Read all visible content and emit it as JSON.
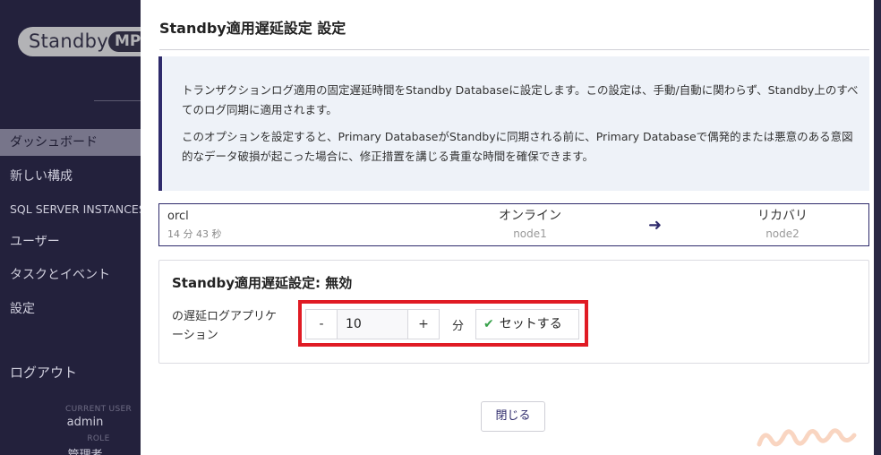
{
  "sidebar": {
    "logo_text": "Standby",
    "logo_badge": "MP",
    "items": [
      {
        "label": "ダッシュボード"
      },
      {
        "label": "新しい構成"
      },
      {
        "label": "SQL SERVER INSTANCES"
      },
      {
        "label": "ユーザー"
      },
      {
        "label": "タスクとイベント"
      },
      {
        "label": "設定"
      }
    ],
    "logout": "ログアウト",
    "current_user_label": "CURRENT USER",
    "current_user": "admin",
    "role_label": "ROLE",
    "role": "管理者"
  },
  "modal": {
    "title": "Standby適用遅延設定 設定",
    "info": {
      "p1": "トランザクションログ適用の固定遅延時間をStandby Databaseに設定します。この設定は、手動/自動に関わらず、Standby上のすべてのログ同期に適用されます。",
      "p2": "このオプションを設定すると、Primary DatabaseがStandbyに同期される前に、Primary Databaseで偶発的または悪意のある意図的なデータ破損が起こった場合に、修正措置を講じる貴重な時間を確保できます。"
    },
    "replication": {
      "db_name": "orcl",
      "elapsed": "14 分 43 秒",
      "source_status": "オンライン",
      "source_node": "node1",
      "target_status": "リカバリ",
      "target_node": "node2"
    },
    "setting": {
      "heading": "Standby適用遅延設定: 無効",
      "label": "の遅延ログアプリケーション",
      "minus": "-",
      "value": "10",
      "plus": "+",
      "unit": "分",
      "set_button": "セットする"
    },
    "close_button": "閉じる"
  },
  "colors": {
    "accent": "#2e2a6b",
    "highlight": "#e01b24",
    "check": "#37a14a",
    "info_bg": "#eef2f8"
  }
}
